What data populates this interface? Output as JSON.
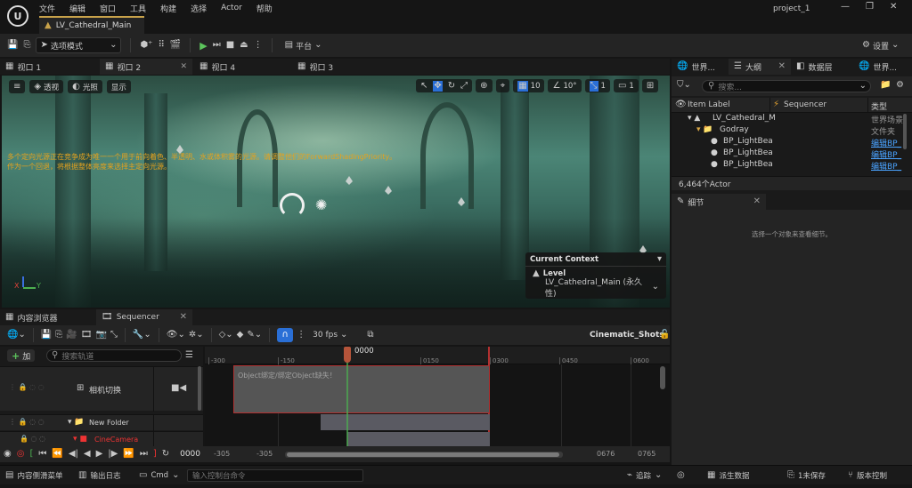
{
  "menu": [
    "文件",
    "编辑",
    "窗口",
    "工具",
    "构建",
    "选择",
    "Actor",
    "帮助"
  ],
  "project_name": "project_1",
  "window_controls": [
    "minimize-icon",
    "restore-icon",
    "close-icon"
  ],
  "map_tab": "LV_Cathedral_Main",
  "toolbar": {
    "select_mode": "选项模式",
    "platform": "平台",
    "settings": "设置"
  },
  "viewport_tabs": [
    "视口 1",
    "视口 2",
    "视口 4",
    "视口 3"
  ],
  "viewport": {
    "perspective": "透视",
    "lighting": "光照",
    "show": "显示",
    "grid_snap": "10",
    "rotate_snap": "10°",
    "scale_snap": "1",
    "camera_speed": "1",
    "warning_line1": "多个定向光源正在竞争成为唯一一个用于前向着色、半透明、水或体积雾的光源。请调整他们的ForwardShadingPriority。",
    "warning_line2": "作为一个回退，将根据整体亮度来选择主定向光源。",
    "axis_x": "X",
    "axis_y": "Y",
    "context": {
      "title": "Current Context",
      "level_label": "Level",
      "level_value": "LV_Cathedral_Main (永久性)"
    }
  },
  "right_tabs": [
    "世界...",
    "大纲",
    "数据层",
    "世界..."
  ],
  "outliner": {
    "search_placeholder": "搜索...",
    "col_label": "Item Label",
    "col_sequencer": "Sequencer",
    "col_type": "类型",
    "rows": [
      {
        "label": "LV_Cathedral_M",
        "type": "世界场景"
      },
      {
        "label": "Godray",
        "type": "文件夹"
      },
      {
        "label": "BP_LightBea",
        "type": "编辑BP_"
      },
      {
        "label": "BP_LightBea",
        "type": "编辑BP_"
      },
      {
        "label": "BP_LightBea",
        "type": "编辑BP_"
      }
    ],
    "actor_count": "6,464个Actor"
  },
  "details": {
    "tab": "细节",
    "empty_msg": "选择一个对象来查看细节。"
  },
  "bottom_tabs": [
    "内容浏览器",
    "Sequencer"
  ],
  "sequencer": {
    "fps": "30 fps",
    "sequence_name": "Cinematic_Shots",
    "add_label": "加",
    "filter_placeholder": "搜索轨道",
    "tracks": [
      "相机切换",
      "New Folder",
      "CineCamera"
    ],
    "playhead": "0000",
    "ruler_labels": [
      "-300",
      "-150",
      "0150",
      "0300",
      "0450",
      "0600"
    ],
    "section_text": "Object绑定/绑定Object缺失！",
    "current_frame": "0000",
    "range_start": "-305",
    "range_start2": "-305",
    "range_end": "0676",
    "range_end2": "0765"
  },
  "statusbar": {
    "content_drawer": "内容侧滑菜单",
    "output_log": "输出日志",
    "cmd": "Cmd",
    "cmd_placeholder": "输入控制台命令",
    "trace": "追踪",
    "derived_data": "派生数据",
    "unsaved": "1未保存",
    "source_control": "版本控制"
  }
}
